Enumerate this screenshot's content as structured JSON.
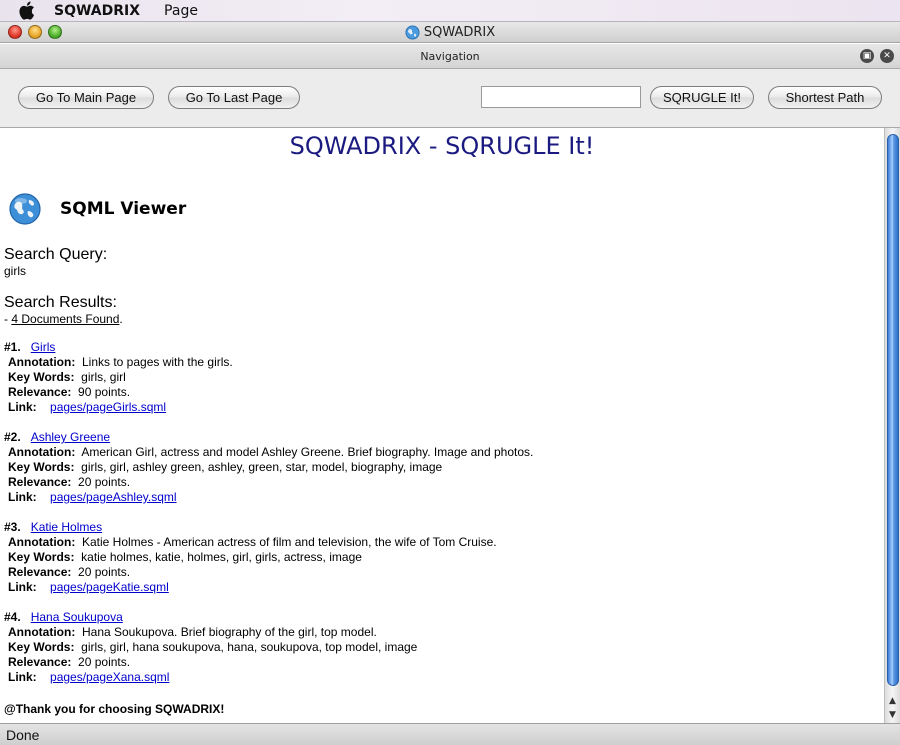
{
  "menubar": {
    "app_name": "SQWADRIX",
    "menu_page": "Page"
  },
  "window": {
    "title": "SQWADRIX"
  },
  "nav_header": {
    "title": "Navigation"
  },
  "toolbar": {
    "main_page_label": "Go To Main Page",
    "last_page_label": "Go To Last Page",
    "search_value": "",
    "sqrugle_label": "SQRUGLE It!",
    "shortest_path_label": "Shortest Path"
  },
  "content": {
    "heading": "SQWADRIX - SQRUGLE It!",
    "viewer_title": "SQML Viewer",
    "search_query_label": "Search Query:",
    "search_query_value": "girls",
    "search_results_label": "Search Results:",
    "results_count_prefix": "- ",
    "results_count": "4 Documents Found",
    "results_count_suffix": ".",
    "labels": {
      "annotation": "Annotation:",
      "keywords": "Key Words:",
      "relevance": "Relevance:",
      "link": "Link:"
    },
    "results": [
      {
        "num": "#1.",
        "title": "Girls",
        "annotation": "Links to pages with the girls.",
        "keywords": "girls, girl",
        "relevance": "90 points.",
        "link": "pages/pageGirls.sqml"
      },
      {
        "num": "#2.",
        "title": "Ashley Greene",
        "annotation": "American Girl, actress and model Ashley Greene. Brief biography. Image and photos.",
        "keywords": "girls, girl, ashley green, ashley, green, star, model, biography, image",
        "relevance": "20 points.",
        "link": "pages/pageAshley.sqml"
      },
      {
        "num": "#3.",
        "title": "Katie Holmes",
        "annotation": "Katie Holmes - American actress of film and television, the wife of Tom Cruise.",
        "keywords": "katie holmes, katie, holmes, girl, girls, actress, image",
        "relevance": "20 points.",
        "link": "pages/pageKatie.sqml"
      },
      {
        "num": "#4.",
        "title": "Hana Soukupova",
        "annotation": "Hana Soukupova. Brief biography of the girl, top model.",
        "keywords": "girls, girl, hana soukupova, hana, soukupova, top model, image",
        "relevance": "20 points.",
        "link": "pages/pageXana.sqml"
      }
    ],
    "thanks": "@Thank you for choosing SQWADRIX!"
  },
  "status": {
    "text": "Done"
  },
  "icons": {
    "apple": "apple-logo-icon",
    "globe": "globe-icon"
  },
  "colors": {
    "heading": "#1a1a80",
    "link": "#0000cc",
    "scroll_thumb": "#5d9be6"
  }
}
